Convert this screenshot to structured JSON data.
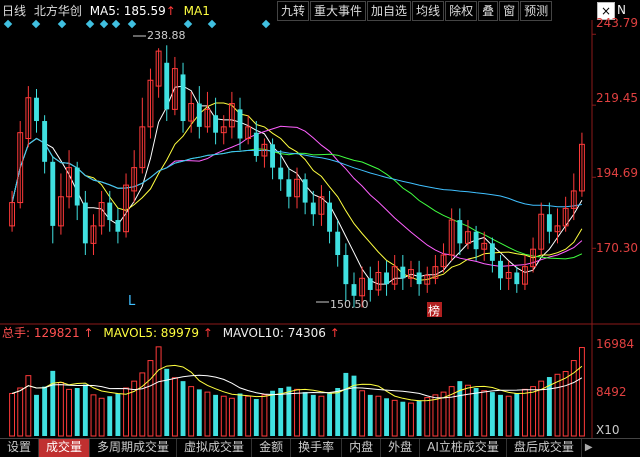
{
  "header": {
    "period": "日线",
    "stock_name": "北方华创",
    "ma5_label": "MA5: 185.59",
    "ma5_arrow": "↑",
    "ma1_label": "MA1"
  },
  "toolbar": {
    "buttons": [
      "九转",
      "重大事件",
      "加自选",
      "均线",
      "除权",
      "叠",
      "窗",
      "预测"
    ],
    "close_symbol": "×",
    "n_label": "N"
  },
  "price_axis": [
    "243.79",
    "219.45",
    "194.69",
    "170.30"
  ],
  "annotations": {
    "high": "238.88",
    "low": "150.50",
    "l_marker": "L",
    "rank_badge": "榜"
  },
  "volume": {
    "total_label": "总手: 129821",
    "total_arrow": "↑",
    "mavol5_label": "MAVOL5: 89979",
    "mavol5_arrow": "↑",
    "mavol10_label": "MAVOL10: 74306",
    "mavol10_arrow": "↑",
    "axis": [
      "16984",
      "8492"
    ],
    "unit": "X10"
  },
  "tabs": {
    "settings": "设置",
    "items": [
      "成交量",
      "多周期成交量",
      "虚拟成交量",
      "金额",
      "换手率",
      "内盘",
      "外盘",
      "AI立桩成交量",
      "盘后成交量"
    ],
    "active_index": 0,
    "more_arrow": "▶"
  },
  "colors": {
    "up": "#ff3a3a",
    "down": "#40e0e0",
    "ma5": "#ffffff",
    "ma10": "#ffff40",
    "ma20": "#ff60ff",
    "ma30": "#40ff40",
    "ma60": "#40c0ff",
    "axis_text": "#e04040"
  },
  "chart_data": {
    "type": "candlestick",
    "y_ticks": [
      243.79,
      219.45,
      194.69,
      170.3
    ],
    "high": 238.88,
    "low": 150.5,
    "candles": [
      [
        178,
        186,
        176,
        190
      ],
      [
        186,
        210,
        184,
        214
      ],
      [
        208,
        222,
        205,
        226
      ],
      [
        222,
        214,
        210,
        225
      ],
      [
        214,
        200,
        196,
        216
      ],
      [
        200,
        178,
        172,
        202
      ],
      [
        178,
        188,
        175,
        196
      ],
      [
        188,
        198,
        184,
        204
      ],
      [
        198,
        185,
        180,
        200
      ],
      [
        186,
        172,
        168,
        190
      ],
      [
        172,
        178,
        168,
        182
      ],
      [
        178,
        186,
        175,
        190
      ],
      [
        186,
        180,
        176,
        190
      ],
      [
        180,
        176,
        172,
        184
      ],
      [
        176,
        192,
        174,
        196
      ],
      [
        190,
        198,
        186,
        204
      ],
      [
        198,
        212,
        196,
        222
      ],
      [
        212,
        228,
        208,
        232
      ],
      [
        226,
        238,
        222,
        239
      ],
      [
        234,
        218,
        214,
        240
      ],
      [
        218,
        232,
        216,
        236
      ],
      [
        230,
        214,
        210,
        234
      ],
      [
        214,
        220,
        210,
        224
      ],
      [
        220,
        212,
        208,
        226
      ],
      [
        212,
        218,
        210,
        224
      ],
      [
        216,
        210,
        206,
        222
      ],
      [
        210,
        212,
        206,
        216
      ],
      [
        212,
        220,
        208,
        224
      ],
      [
        218,
        208,
        204,
        222
      ],
      [
        208,
        212,
        206,
        216
      ],
      [
        210,
        202,
        200,
        214
      ],
      [
        202,
        206,
        198,
        208
      ],
      [
        206,
        198,
        194,
        208
      ],
      [
        198,
        194,
        190,
        204
      ],
      [
        194,
        188,
        184,
        198
      ],
      [
        188,
        194,
        184,
        198
      ],
      [
        194,
        186,
        182,
        196
      ],
      [
        186,
        182,
        178,
        190
      ],
      [
        182,
        188,
        178,
        192
      ],
      [
        186,
        176,
        172,
        190
      ],
      [
        176,
        168,
        164,
        180
      ],
      [
        168,
        158,
        152,
        172
      ],
      [
        158,
        154,
        150,
        162
      ],
      [
        154,
        160,
        150,
        164
      ],
      [
        160,
        156,
        152,
        164
      ],
      [
        156,
        162,
        154,
        166
      ],
      [
        162,
        158,
        154,
        166
      ],
      [
        158,
        164,
        156,
        168
      ],
      [
        164,
        160,
        156,
        168
      ],
      [
        160,
        163,
        157,
        166
      ],
      [
        162,
        158,
        154,
        166
      ],
      [
        158,
        161,
        155,
        164
      ],
      [
        160,
        164,
        158,
        168
      ],
      [
        164,
        168,
        162,
        172
      ],
      [
        168,
        180,
        166,
        184
      ],
      [
        180,
        172,
        168,
        184
      ],
      [
        172,
        176,
        170,
        180
      ],
      [
        176,
        170,
        166,
        178
      ],
      [
        170,
        172,
        166,
        176
      ],
      [
        172,
        166,
        162,
        174
      ],
      [
        166,
        160,
        156,
        168
      ],
      [
        160,
        162,
        156,
        166
      ],
      [
        162,
        158,
        155,
        164
      ],
      [
        158,
        164,
        156,
        168
      ],
      [
        164,
        170,
        162,
        174
      ],
      [
        170,
        182,
        168,
        186
      ],
      [
        182,
        176,
        172,
        186
      ],
      [
        176,
        178,
        172,
        184
      ],
      [
        178,
        184,
        176,
        188
      ],
      [
        184,
        190,
        180,
        196
      ],
      [
        190,
        206,
        188,
        210
      ]
    ],
    "volumes": [
      62,
      70,
      88,
      60,
      72,
      95,
      78,
      68,
      70,
      75,
      60,
      55,
      58,
      62,
      70,
      80,
      92,
      110,
      130,
      98,
      85,
      80,
      72,
      68,
      64,
      60,
      58,
      55,
      62,
      58,
      54,
      60,
      66,
      70,
      72,
      68,
      64,
      60,
      58,
      62,
      70,
      92,
      88,
      66,
      60,
      58,
      55,
      52,
      50,
      48,
      52,
      56,
      60,
      64,
      72,
      80,
      74,
      70,
      66,
      64,
      60,
      58,
      62,
      68,
      72,
      80,
      86,
      90,
      94,
      110,
      129
    ]
  }
}
